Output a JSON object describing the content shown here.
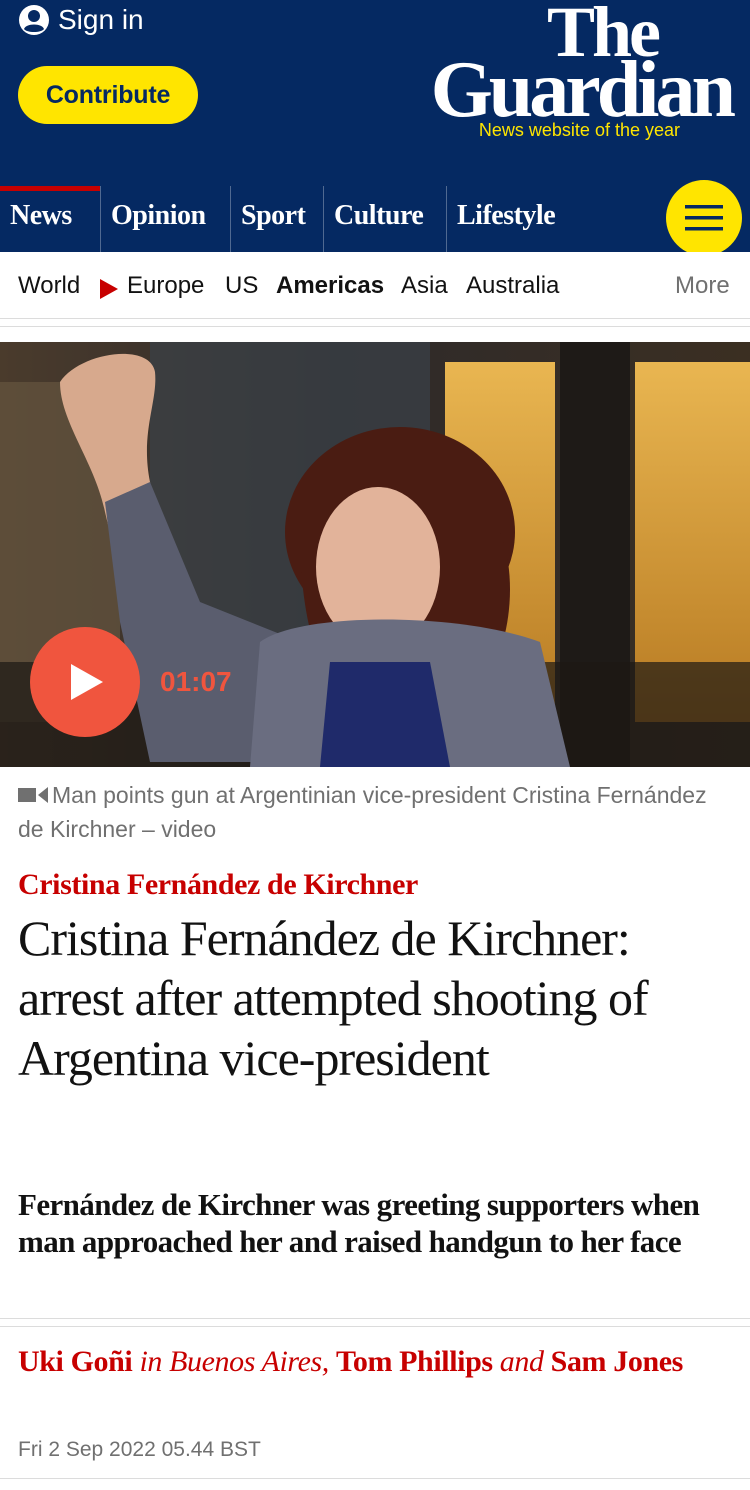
{
  "header": {
    "sign_in": "Sign in",
    "contribute": "Contribute",
    "logo_the": "The",
    "logo_guardian": "Guardian",
    "tagline": "News website of the year"
  },
  "pillars": [
    "News",
    "Opinion",
    "Sport",
    "Culture",
    "Lifestyle"
  ],
  "subnav": {
    "items": [
      "World",
      "Europe",
      "US",
      "Americas",
      "Asia",
      "Australia"
    ],
    "more": "More"
  },
  "media": {
    "duration": "01:07",
    "caption": "Man points gun at Argentinian vice-president Cristina Fernández de Kirchner – video"
  },
  "article": {
    "kicker": "Cristina Fernández de Kirchner",
    "headline": "Cristina Fernández de Kirchner: arrest after attempted shooting of Argentina vice-president",
    "standfirst": "Fernández de Kirchner was greeting supporters when man approached her and raised handgun to her face",
    "byline": {
      "author1": "Uki Goñi",
      "location": "in Buenos Aires,",
      "author2": "Tom Phillips",
      "and": "and",
      "author3": "Sam Jones"
    },
    "date": "Fri 2 Sep 2022 05.44 BST"
  },
  "colors": {
    "brand_blue": "#052962",
    "yellow": "#ffe500",
    "news_red": "#c70000",
    "video_orange": "#f0553e"
  }
}
